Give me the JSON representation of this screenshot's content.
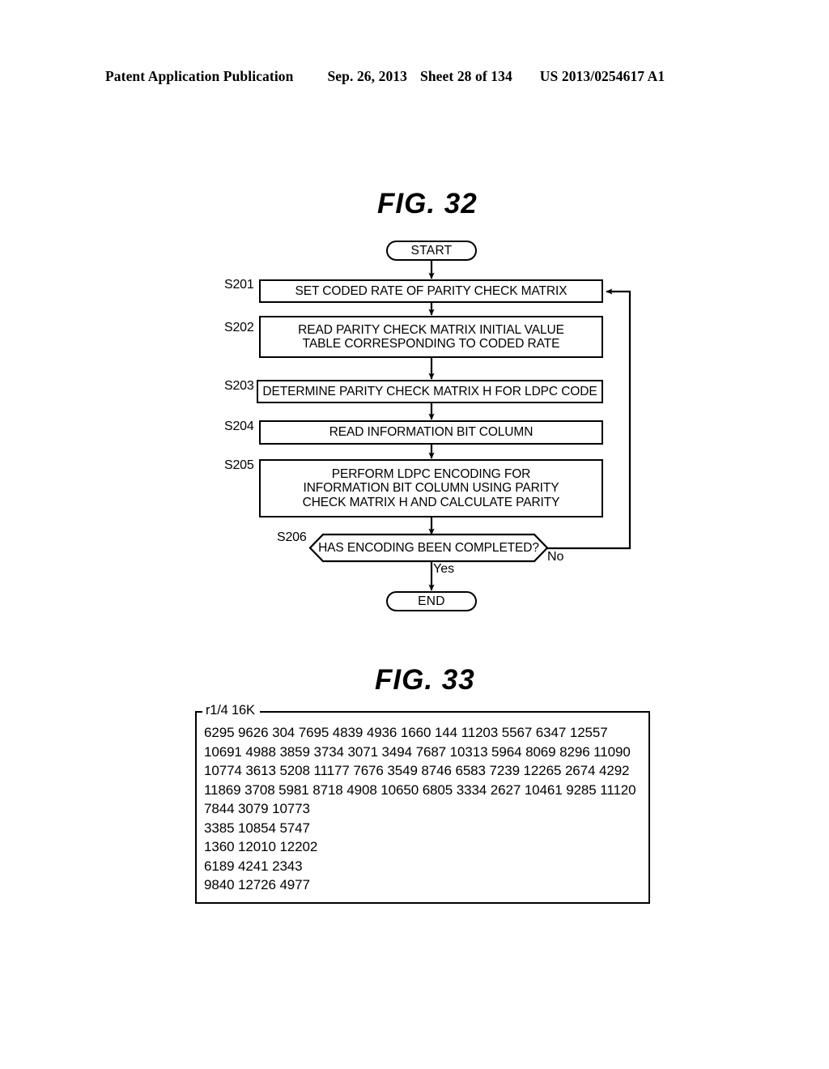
{
  "header": {
    "publication": "Patent Application Publication",
    "date": "Sep. 26, 2013",
    "sheet": "Sheet 28 of 134",
    "patent_number": "US 2013/0254617 A1"
  },
  "figures": {
    "fig32": {
      "title": "FIG. 32",
      "nodes": {
        "start": "START",
        "end": "END",
        "s201": "SET CODED RATE OF PARITY CHECK MATRIX",
        "s202": "READ PARITY CHECK MATRIX INITIAL VALUE\nTABLE CORRESPONDING TO CODED RATE",
        "s203": "DETERMINE PARITY CHECK MATRIX H FOR LDPC CODE",
        "s204": "READ INFORMATION BIT COLUMN",
        "s205": "PERFORM LDPC ENCODING FOR\nINFORMATION BIT  COLUMN USING PARITY\nCHECK MATRIX H AND CALCULATE PARITY",
        "s206": "HAS ENCODING BEEN COMPLETED?"
      },
      "step_labels": {
        "s201": "S201",
        "s202": "S202",
        "s203": "S203",
        "s204": "S204",
        "s205": "S205",
        "s206": "S206"
      },
      "edge_labels": {
        "yes": "Yes",
        "no": "No"
      }
    },
    "fig33": {
      "title": "FIG. 33",
      "table_label": "r1/4 16K",
      "rows": [
        "6295 9626 304 7695 4839 4936 1660 144 11203 5567 6347 12557",
        "10691 4988 3859 3734 3071 3494 7687 10313 5964 8069 8296 11090",
        "10774 3613 5208 11177 7676 3549 8746 6583 7239 12265 2674 4292",
        "11869 3708 5981 8718 4908 10650 6805 3334 2627 10461 9285 11120",
        "7844 3079 10773",
        "3385 10854 5747",
        "1360 12010 12202",
        "6189 4241 2343",
        "9840 12726 4977"
      ]
    }
  },
  "colors": {
    "ink": "#000000",
    "paper": "#ffffff"
  }
}
